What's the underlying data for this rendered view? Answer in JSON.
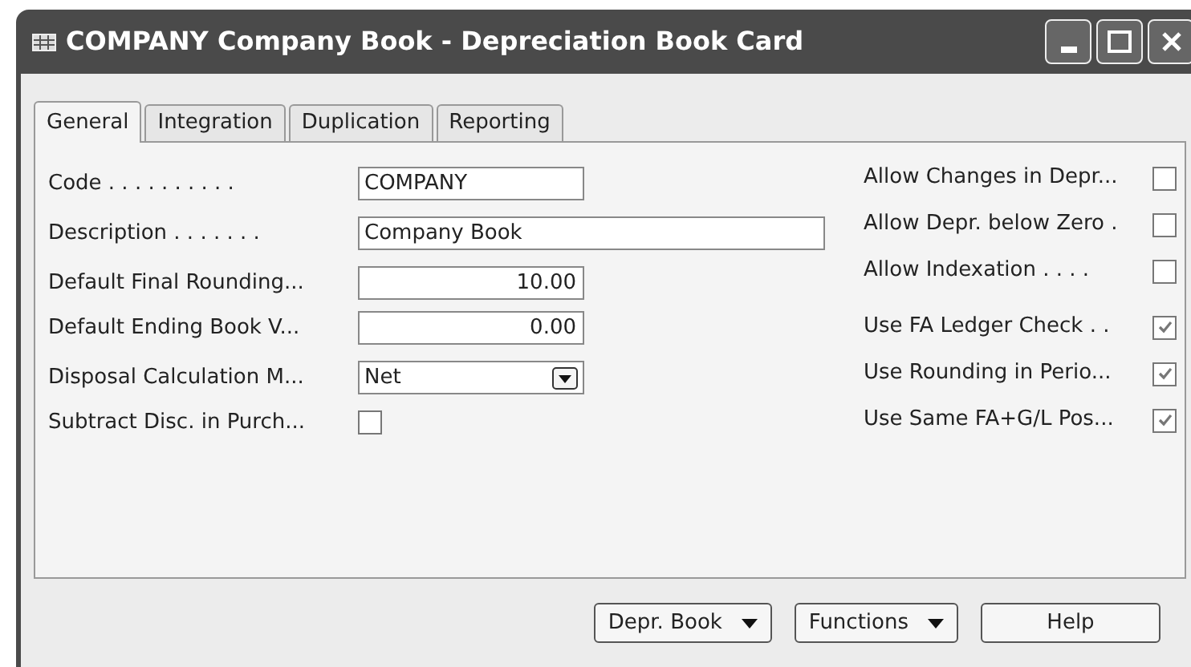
{
  "window": {
    "title": "COMPANY Company Book - Depreciation Book Card"
  },
  "tabs": [
    {
      "label": "General",
      "selected": true
    },
    {
      "label": "Integration",
      "selected": false
    },
    {
      "label": "Duplication",
      "selected": false
    },
    {
      "label": "Reporting",
      "selected": false
    }
  ],
  "left_fields": [
    {
      "kind": "text",
      "label": "Code . . . . . . . . . .",
      "value": "COMPANY"
    },
    {
      "kind": "wide_text",
      "label": "Description . . . . . . .",
      "value": "Company Book"
    },
    {
      "kind": "number",
      "label": "Default Final Rounding...",
      "value": "10.00"
    },
    {
      "kind": "number",
      "label": "Default Ending Book V...",
      "value": "0.00"
    },
    {
      "kind": "dropdown",
      "label": "Disposal Calculation M...",
      "value": "Net"
    },
    {
      "kind": "checkbox",
      "label": "Subtract Disc. in Purch...",
      "checked": false
    }
  ],
  "right_fields": [
    {
      "label": "Allow Changes in Depr...",
      "checked": false
    },
    {
      "label": "Allow Depr. below Zero  .",
      "checked": false
    },
    {
      "label": "Allow Indexation  . . . .",
      "checked": false
    },
    {
      "label": "Use FA Ledger Check  . .",
      "checked": true
    },
    {
      "label": "Use Rounding in Perio...",
      "checked": true
    },
    {
      "label": "Use Same FA+G/L Pos...",
      "checked": true
    }
  ],
  "buttons": [
    {
      "label": "Depr. Book",
      "menu": true
    },
    {
      "label": "Functions",
      "menu": true
    },
    {
      "label": "Help",
      "menu": false
    }
  ]
}
